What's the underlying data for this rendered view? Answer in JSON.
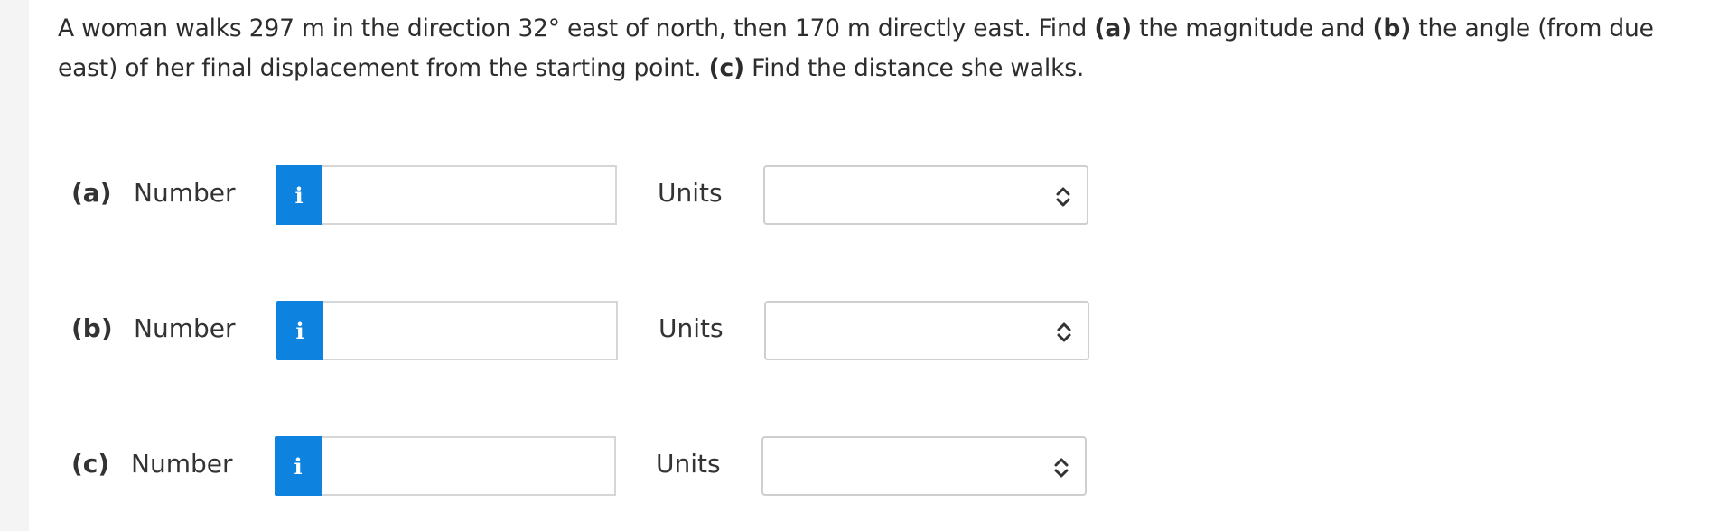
{
  "question": {
    "text_1": "A woman walks 297 m in the direction 32° east of north, then 170 m directly east. Find ",
    "bold_a": "(a)",
    "text_2": " the magnitude and ",
    "bold_b": "(b)",
    "text_3": " the angle (from due east) of her final displacement from the starting point. ",
    "bold_c": "(c)",
    "text_4": " Find the distance she walks."
  },
  "parts": [
    {
      "label": "(a)",
      "number_label": "Number",
      "info_icon": "i",
      "number_value": "",
      "units_label": "Units",
      "units_value": ""
    },
    {
      "label": "(b)",
      "number_label": "Number",
      "info_icon": "i",
      "number_value": "",
      "units_label": "Units",
      "units_value": ""
    },
    {
      "label": "(c)",
      "number_label": "Number",
      "info_icon": "i",
      "number_value": "",
      "units_label": "Units",
      "units_value": ""
    }
  ],
  "icons": {
    "info": "info-icon",
    "select_arrow": "chevron-up-down-icon"
  },
  "colors": {
    "accent": "#0d82df",
    "text": "#333333",
    "border": "#d6d6d6",
    "background": "#f4f4f4"
  }
}
